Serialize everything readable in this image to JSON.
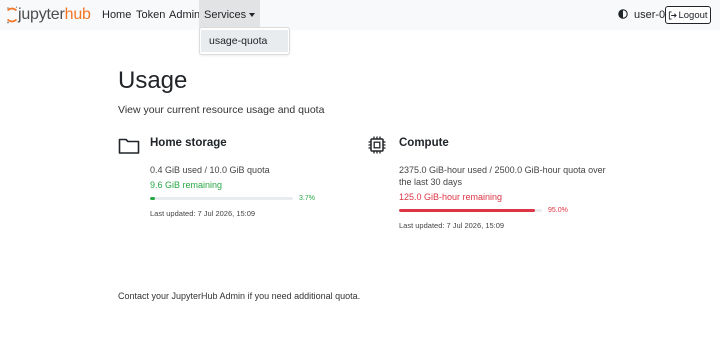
{
  "nav": {
    "brand_part1": "jupyter",
    "brand_part2": "hub",
    "home": "Home",
    "token": "Token",
    "admin": "Admin",
    "services": "Services",
    "user": "user-0",
    "logout": "Logout"
  },
  "dropdown": {
    "items": [
      "usage-quota"
    ]
  },
  "page": {
    "title": "Usage",
    "subtitle": "View your current resource usage and quota",
    "footer": "Contact your JupyterHub Admin if you need additional quota."
  },
  "storage": {
    "title": "Home storage",
    "usage": "0.4 GiB used / 10.0 GiB quota",
    "remaining": "9.6 GiB remaining",
    "percent": 3.7,
    "percent_label": "3.7%",
    "updated": "Last updated: 7 Jul 2026, 15:09",
    "color": "#28a745"
  },
  "compute": {
    "title": "Compute",
    "usage_line1": "2375.0 GiB-hour used / 2500.0 GiB-hour quota over",
    "usage_line2": "the last 30 days",
    "remaining": "125.0 GiB-hour remaining",
    "percent": 95.0,
    "percent_label": "95.0%",
    "updated": "Last updated: 7 Jul 2026, 15:09",
    "color": "#dc3545"
  },
  "icons": {
    "brand": "jupyter-logo-icon",
    "theme": "half-circle-icon",
    "logout": "sign-out-icon",
    "storage": "folder-icon",
    "compute": "cpu-chip-icon"
  }
}
